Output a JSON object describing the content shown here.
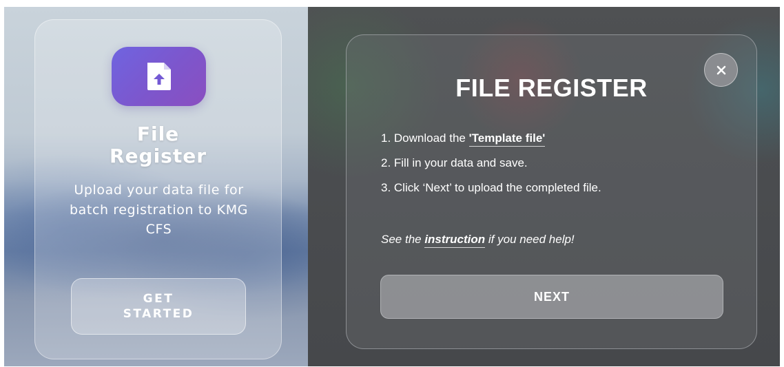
{
  "left_card": {
    "icon": "file-upload-icon",
    "title_line1": "File",
    "title_line2": "Register",
    "description": "Upload your data file for batch registration to KMG CFS",
    "button_line1": "GET",
    "button_line2": "STARTED"
  },
  "modal": {
    "close_icon": "close-icon",
    "close_glyph": "×",
    "title": "FILE REGISTER",
    "step1_prefix": "1. Download the ",
    "step1_link": "'Template file'",
    "step2": "2. Fill in your data and save.",
    "step3": "3. Click ‘Next’ to upload the completed file.",
    "help_prefix": "See the ",
    "help_link": "instruction",
    "help_suffix": " if you need help!",
    "next_label": "NEXT"
  },
  "colors": {
    "icon_gradient_start": "#6f64e0",
    "icon_gradient_end": "#8a4fc0",
    "text": "#ffffff"
  }
}
